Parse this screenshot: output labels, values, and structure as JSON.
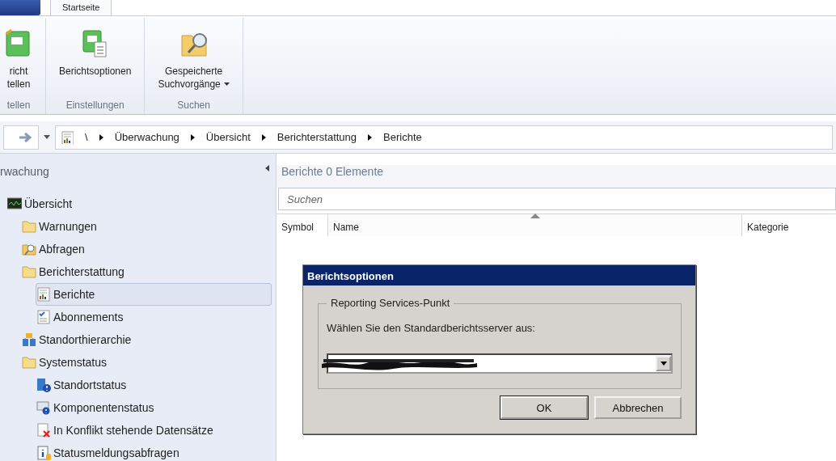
{
  "ribbon": {
    "tabs": [
      {
        "label": "Startseite",
        "selected": true
      }
    ],
    "groups": [
      {
        "label": "tellen",
        "buttons": [
          {
            "kind": "create",
            "lines": [
              "richt",
              "tellen"
            ],
            "dropdown": false
          }
        ]
      },
      {
        "label": "Einstellungen",
        "buttons": [
          {
            "kind": "options",
            "lines": [
              "Berichtsoptionen"
            ],
            "dropdown": false
          }
        ]
      },
      {
        "label": "Suchen",
        "buttons": [
          {
            "kind": "saved-search",
            "lines": [
              "Gespeicherte",
              "Suchvorgänge"
            ],
            "dropdown": true
          }
        ]
      }
    ]
  },
  "navigation": {
    "path": [
      "\\",
      "Überwachung",
      "Übersicht",
      "Berichterstattung",
      "Berichte"
    ]
  },
  "workspace": {
    "title": "rwachung",
    "tree": [
      {
        "label": "Übersicht",
        "kind": "monitor",
        "selected": false,
        "children": [
          {
            "label": "Warnungen",
            "kind": "folder",
            "selected": false
          },
          {
            "label": "Abfragen",
            "kind": "query",
            "selected": false
          },
          {
            "label": "Berichterstattung",
            "kind": "folder",
            "selected": false,
            "children": [
              {
                "label": "Berichte",
                "kind": "report",
                "selected": true
              },
              {
                "label": "Abonnements",
                "kind": "checklist",
                "selected": false
              }
            ]
          },
          {
            "label": "Standorthierarchie",
            "kind": "sites",
            "selected": false
          },
          {
            "label": "Systemstatus",
            "kind": "folder",
            "selected": false,
            "children": [
              {
                "label": "Standortstatus",
                "kind": "site-status",
                "selected": false
              },
              {
                "label": "Komponentenstatus",
                "kind": "component",
                "selected": false
              },
              {
                "label": "In Konflikt stehende Datensätze",
                "kind": "conflict",
                "selected": false
              },
              {
                "label": "Statusmeldungsabfragen",
                "kind": "info",
                "selected": false
              }
            ]
          }
        ]
      }
    ]
  },
  "list_view": {
    "title": "Berichte",
    "count": "0 Elemente",
    "search": {
      "placeholder": "Suchen"
    },
    "columns": [
      {
        "label": "Symbol",
        "sorted": false
      },
      {
        "label": "Name",
        "sorted": true
      },
      {
        "label": "Kategorie",
        "sorted": false
      }
    ]
  },
  "dialog": {
    "title": "Berichtsoptionen",
    "group_label": "Reporting Services-Punkt",
    "prompt": "Wählen Sie den Standardberichtsserver aus:",
    "server": {
      "redacted": true
    },
    "buttons": [
      {
        "label": "OK",
        "default": true
      },
      {
        "label": "Abbrechen",
        "default": false
      }
    ]
  }
}
